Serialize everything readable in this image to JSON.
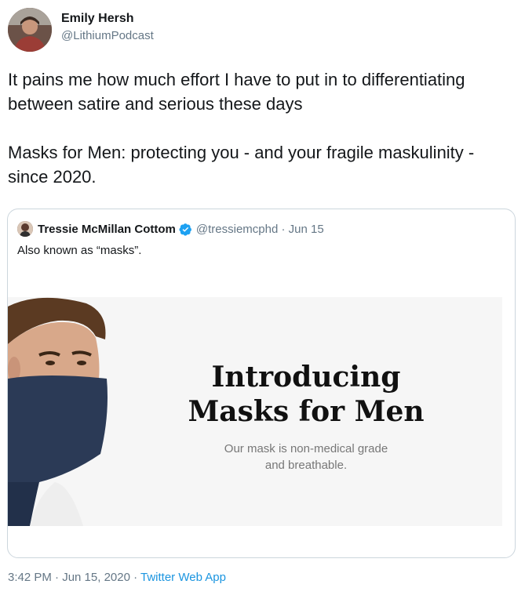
{
  "author": {
    "name": "Emily Hersh",
    "handle": "@LithiumPodcast"
  },
  "tweet": {
    "paragraph1": "It pains me how much effort I have to put in to differentiating between satire and serious these days",
    "paragraph2": "Masks for Men: protecting you - and your fragile maskulinity - since 2020."
  },
  "quoted": {
    "name": "Tressie McMillan Cottom",
    "handle_date": "@tressiemcphd · Jun 15",
    "text": "Also known as “masks”.",
    "media": {
      "headline_line1": "Introducing",
      "headline_line2": "Masks for Men",
      "subtitle_line1": "Our mask is non-medical grade",
      "subtitle_line2": "and breathable."
    }
  },
  "meta": {
    "timestamp": "3:42 PM · Jun 15, 2020 · ",
    "source": "Twitter Web App"
  },
  "colors": {
    "text": "#14171a",
    "secondary": "#657786",
    "link": "#1b95e0",
    "verified": "#1da1f2",
    "border": "#ccd6dd"
  }
}
